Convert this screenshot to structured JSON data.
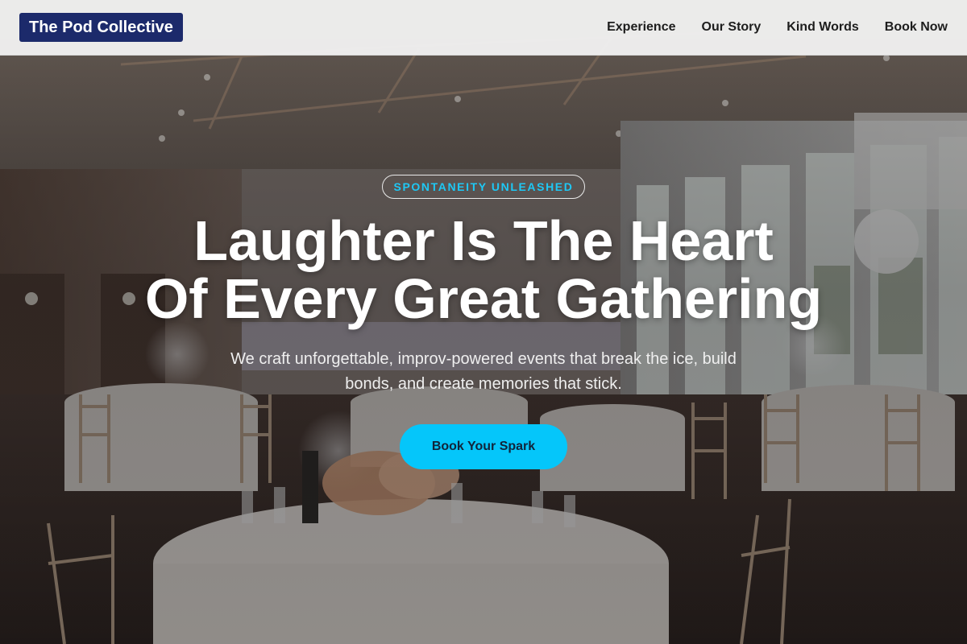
{
  "nav": {
    "logo": "The Pod Collective",
    "links": [
      "Experience",
      "Our Story",
      "Kind Words",
      "Book Now"
    ]
  },
  "hero": {
    "badge": "SPONTANEITY UNLEASHED",
    "headline_line1": "Laughter Is The Heart",
    "headline_line2": "Of Every Great Gathering",
    "subtext": "We craft unforgettable, improv-powered events that break the ice, build bonds, and create memories that stick.",
    "cta_label": "Book Your Spark",
    "background_image": "banquet hall with round tables, white tablecloths, chiavari chairs and floral centerpieces"
  },
  "colors": {
    "accent": "#05c6fa",
    "badge_text": "#1ec8f5",
    "logo_bg": "#1c2a6b",
    "nav_bg": "#f0f0f0"
  }
}
